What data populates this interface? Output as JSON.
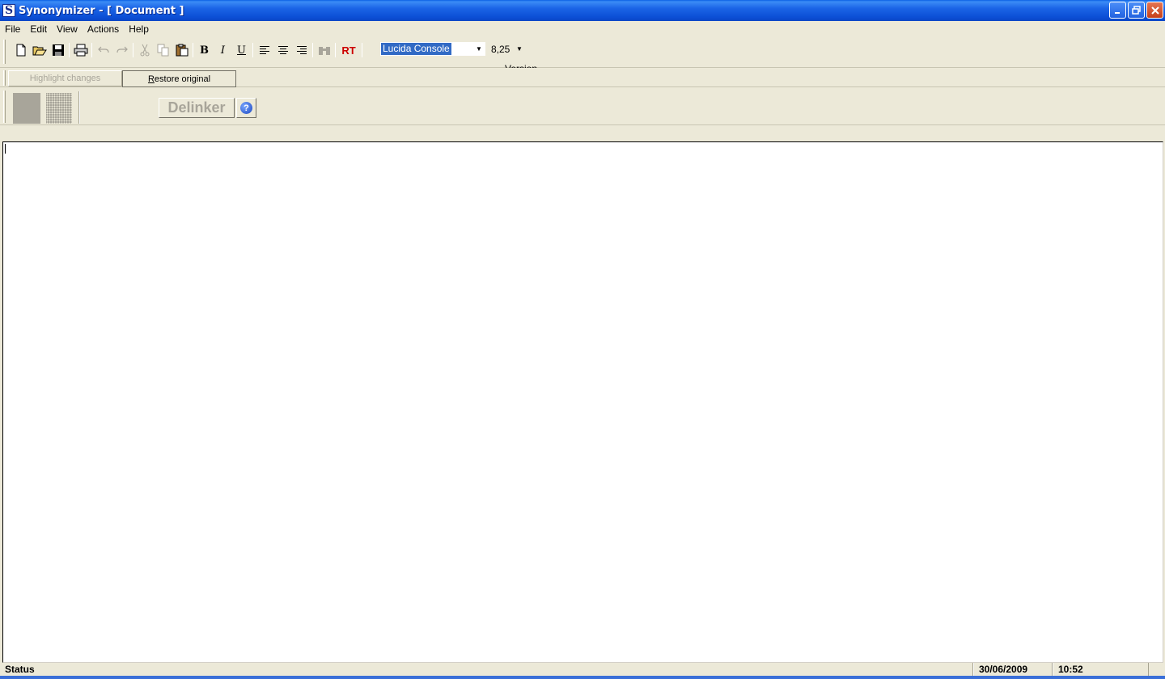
{
  "window": {
    "title": "Synonymizer - [ Document ]",
    "app_icon_letter": "S"
  },
  "menu": [
    "File",
    "Edit",
    "View",
    "Actions",
    "Help"
  ],
  "toolbar": {
    "rt_label": "RT",
    "font_name": "Lucida Console",
    "font_size": "8,25",
    "version_label": "Version",
    "highlight_color": "#316ac5",
    "rt_color": "#cc0000"
  },
  "toolbar2": {
    "highlight_changes": "Highlight changes",
    "restore_original": "Restore original"
  },
  "toolbar3": {
    "delinker": "Delinker",
    "help": "?"
  },
  "document": {
    "content": ""
  },
  "status": {
    "label": "Status",
    "date": "30/06/2009",
    "time": "10:52"
  }
}
